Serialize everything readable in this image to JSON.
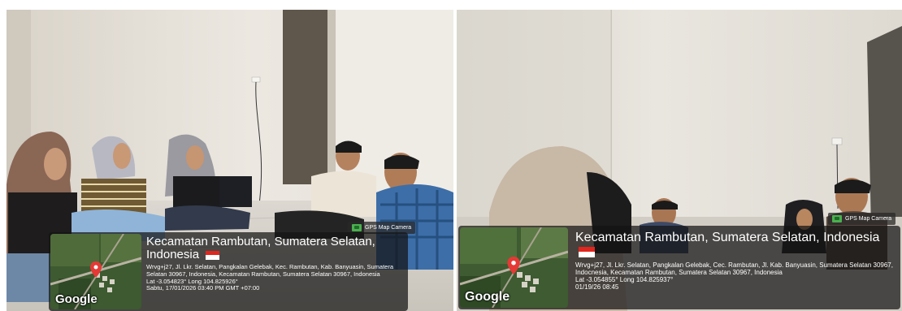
{
  "photos": [
    {
      "gps_badge": "GPS Map Camera",
      "map_label": "Google",
      "title": "Kecamatan Rambutan, Sumatera Selatan, Indonesia",
      "address": "Wrvg+j27, Jl. Lkr. Selatan, Pangkalan Gelebak, Kec. Rambutan, Kab. Banyuasin, Sumatera Selatan 30967, Indonesia, Kecamatan Rambutan, Sumatera Selatan 30967, Indonesia",
      "coords": "Lat -3.054823° Long 104.825926°",
      "timestamp": "Sabtu, 17/01/2026 03:40 PM GMT +07:00"
    },
    {
      "gps_badge": "GPS Map Camera",
      "map_label": "Google",
      "title": "Kecamatan Rambutan, Sumatera Selatan, Indonesia",
      "address": "Wrvg+j27, Jl. Lkr. Selatan, Pangkalan Gelebak, Cec. Rambutan, Jl. Kab. Banyuasin, Sumatera Selatan 30967, Indocnesia, Kecamatan Rambutan, Sumatera Selatan 30967, Indonesia",
      "coords": "Lat -3.054855° Long 104.825937°",
      "timestamp": "01/19/26 08:45"
    }
  ],
  "colors": {
    "wall": "#e6e2da",
    "floor": "#ddd8cf",
    "overlay": "#141414",
    "flag_red": "#e0261e",
    "flag_white": "#ffffff",
    "pin": "#e53935"
  },
  "icons": [
    "gps-camera-icon",
    "location-pin-icon",
    "indonesia-flag-icon"
  ]
}
